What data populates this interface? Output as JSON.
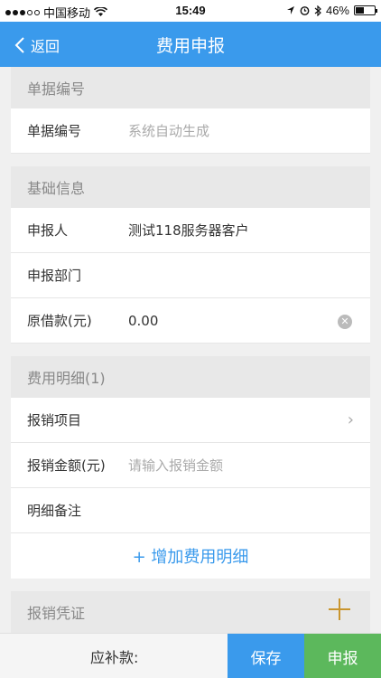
{
  "status_bar": {
    "carrier": "中国移动",
    "time": "15:49",
    "battery": "46%"
  },
  "nav": {
    "back_label": "返回",
    "title": "费用申报"
  },
  "sections": {
    "doc_no": {
      "header": "单据编号",
      "label": "单据编号",
      "value": "系统自动生成"
    },
    "basic": {
      "header": "基础信息",
      "applicant_label": "申报人",
      "applicant_value": "测试118服务器客户",
      "dept_label": "申报部门",
      "dept_value": "",
      "loan_label": "原借款(元)",
      "loan_value": "0.00"
    },
    "detail": {
      "header": "费用明细(1)",
      "item_label": "报销项目",
      "amount_label": "报销金额(元)",
      "amount_placeholder": "请输入报销金额",
      "note_label": "明细备注",
      "add_label": "+ 增加费用明细"
    },
    "voucher": {
      "header": "报销凭证"
    }
  },
  "bottom": {
    "due_label": "应补款:",
    "save_label": "保存",
    "submit_label": "申报"
  },
  "colors": {
    "primary": "#3a9aec",
    "submit": "#5cb85c",
    "accent": "#c9952e"
  }
}
